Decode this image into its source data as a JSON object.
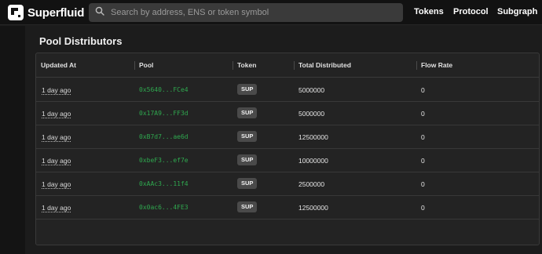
{
  "header": {
    "brand": "Superfluid",
    "search_placeholder": "Search by address, ENS or token symbol",
    "nav": [
      "Tokens",
      "Protocol",
      "Subgraph"
    ]
  },
  "section": {
    "title": "Pool Distributors"
  },
  "table": {
    "columns": [
      "Updated At",
      "Pool",
      "Token",
      "Total Distributed",
      "Flow Rate"
    ],
    "rows": [
      {
        "updated": "1 day ago",
        "pool": "0x5640...FCe4",
        "token": "SUP",
        "total": "5000000",
        "flow": "0"
      },
      {
        "updated": "1 day ago",
        "pool": "0x17A9...FF3d",
        "token": "SUP",
        "total": "5000000",
        "flow": "0"
      },
      {
        "updated": "1 day ago",
        "pool": "0xB7d7...ae6d",
        "token": "SUP",
        "total": "12500000",
        "flow": "0"
      },
      {
        "updated": "1 day ago",
        "pool": "0xbeF3...ef7e",
        "token": "SUP",
        "total": "10000000",
        "flow": "0"
      },
      {
        "updated": "1 day ago",
        "pool": "0xAAc3...11f4",
        "token": "SUP",
        "total": "2500000",
        "flow": "0"
      },
      {
        "updated": "1 day ago",
        "pool": "0x0ac6...4FE3",
        "token": "SUP",
        "total": "12500000",
        "flow": "0"
      }
    ]
  },
  "colors": {
    "background": "#1c1c1c",
    "address": "#2fa84f",
    "badge": "#4a4a4a"
  },
  "icons": {
    "logo": "superfluid-logo-icon",
    "search": "search-icon"
  }
}
